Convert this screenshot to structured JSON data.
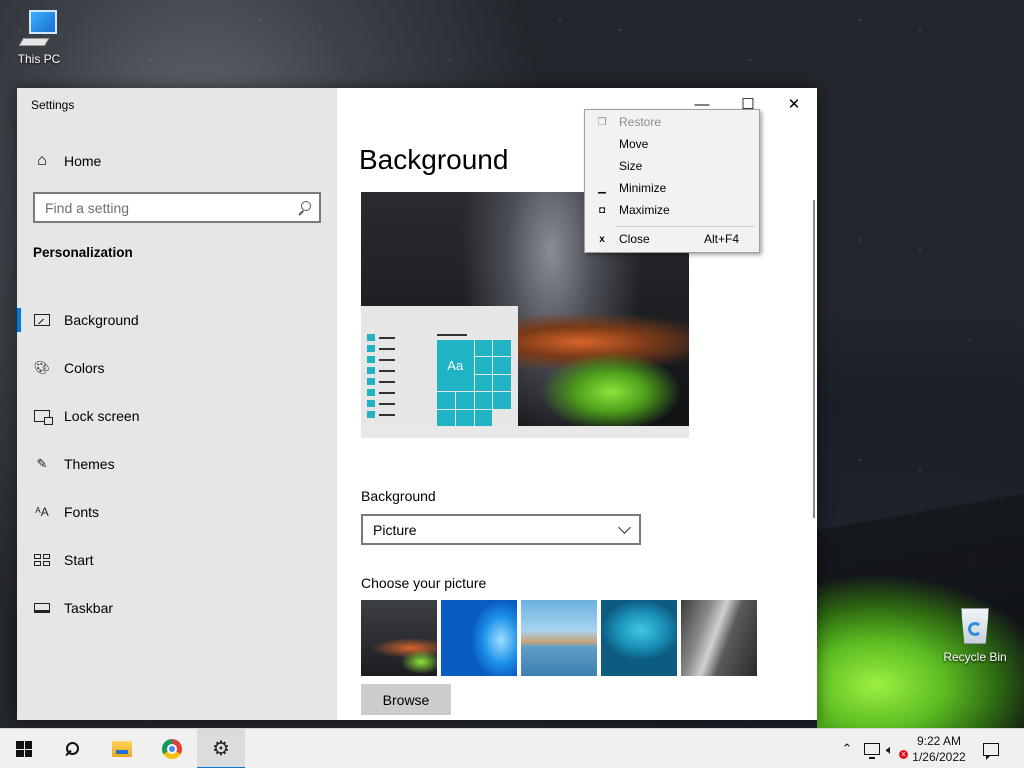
{
  "desktop": {
    "icons": [
      {
        "label": "This PC",
        "icon": "computer-icon"
      },
      {
        "label": "Recycle Bin",
        "icon": "recycle-bin-icon"
      }
    ]
  },
  "window": {
    "title": "Settings",
    "controls": {
      "minimize": "—",
      "maximize": "☐",
      "close": "✕"
    }
  },
  "sidebar": {
    "home_label": "Home",
    "search_placeholder": "Find a setting",
    "section_title": "Personalization",
    "items": [
      {
        "label": "Background",
        "icon": "image-icon",
        "active": true
      },
      {
        "label": "Colors",
        "icon": "palette-icon",
        "active": false
      },
      {
        "label": "Lock screen",
        "icon": "lock-screen-icon",
        "active": false
      },
      {
        "label": "Themes",
        "icon": "themes-icon",
        "active": false
      },
      {
        "label": "Fonts",
        "icon": "fonts-icon",
        "active": false
      },
      {
        "label": "Start",
        "icon": "start-icon",
        "active": false
      },
      {
        "label": "Taskbar",
        "icon": "taskbar-icon",
        "active": false
      }
    ]
  },
  "main": {
    "title": "Background",
    "preview_tile_text": "Aa",
    "background_label": "Background",
    "background_value": "Picture",
    "choose_label": "Choose your picture",
    "browse_label": "Browse"
  },
  "context_menu": {
    "items": [
      {
        "label": "Restore",
        "icon": "restore-icon",
        "disabled": true,
        "shortcut": ""
      },
      {
        "label": "Move",
        "icon": "",
        "disabled": false,
        "shortcut": ""
      },
      {
        "label": "Size",
        "icon": "",
        "disabled": false,
        "shortcut": ""
      },
      {
        "label": "Minimize",
        "icon": "minimize-icon",
        "disabled": false,
        "shortcut": ""
      },
      {
        "label": "Maximize",
        "icon": "maximize-icon",
        "disabled": false,
        "shortcut": ""
      },
      {
        "label": "Close",
        "icon": "close-icon",
        "disabled": false,
        "shortcut": "Alt+F4"
      }
    ]
  },
  "taskbar": {
    "time": "9:22 AM",
    "date": "1/26/2022",
    "accent": "#0078d7"
  }
}
